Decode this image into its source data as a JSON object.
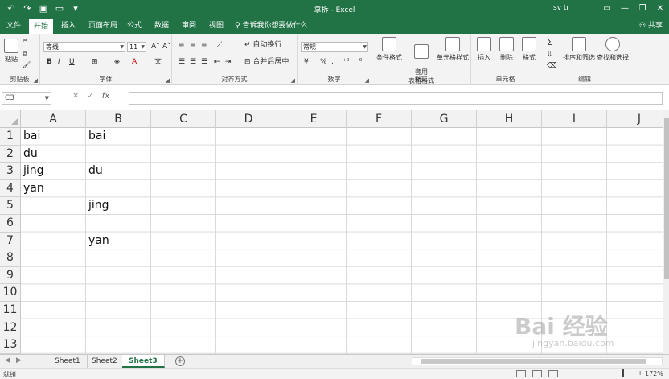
{
  "app": {
    "title": "拿拆 - Excel",
    "user": "sv tr",
    "share_label": "共享",
    "tell_me": "告诉我你想要做什么",
    "window_controls": [
      "—",
      "❐",
      "✕"
    ],
    "accent_color": "#217346"
  },
  "ribbon_tabs": [
    "文件",
    "开始",
    "插入",
    "页面布局",
    "公式",
    "数据",
    "审阅",
    "视图"
  ],
  "ribbon": {
    "clipboard": {
      "label": "剪贴板",
      "paste": "粘贴"
    },
    "font": {
      "label": "字体",
      "font_name": "等线",
      "font_size": "11",
      "bold": "B",
      "italic": "I",
      "underline": "U",
      "grow": "A˄",
      "shrink": "A˅",
      "font_color": "A"
    },
    "alignment": {
      "label": "对齐方式",
      "wrap": "自动换行",
      "merge": "合并后居中"
    },
    "number": {
      "label": "数字",
      "format": "常规",
      "percent": "%",
      "comma": ","
    },
    "styles": {
      "label": "样式",
      "cond": "条件格式",
      "table": "套用\n表格格式",
      "cell": "单元格样式"
    },
    "cells": {
      "label": "单元格",
      "insert": "插入",
      "delete": "删除",
      "format": "格式"
    },
    "editing": {
      "label": "编辑",
      "sort": "排序和筛选",
      "find": "查找和选择",
      "sum": "Σ"
    }
  },
  "formula_bar": {
    "name_box": "C3",
    "cancel": "✕",
    "enter": "✓",
    "fx": "fx",
    "value": ""
  },
  "grid": {
    "columns": [
      "A",
      "B",
      "C",
      "D",
      "E",
      "F",
      "G",
      "H",
      "I",
      "J"
    ],
    "rows": [
      "1",
      "2",
      "3",
      "4",
      "5",
      "6",
      "7",
      "8",
      "9",
      "10",
      "11",
      "12",
      "13"
    ],
    "cells": {
      "A1": "bai",
      "B1": "bai",
      "A2": "du",
      "A3": "jing",
      "B3": "du",
      "A4": "yan",
      "B5": "jing",
      "B7": "yan"
    }
  },
  "sheets": [
    {
      "name": "Sheet1",
      "active": false
    },
    {
      "name": "Sheet2",
      "active": false
    },
    {
      "name": "Sheet3",
      "active": true
    }
  ],
  "status": {
    "ready": "就绪",
    "zoom_minus": "−",
    "zoom_plus": "+",
    "zoom_level": "172%"
  },
  "watermark": {
    "text": "Bai 经验",
    "sub": "jingyan.baidu.com"
  }
}
